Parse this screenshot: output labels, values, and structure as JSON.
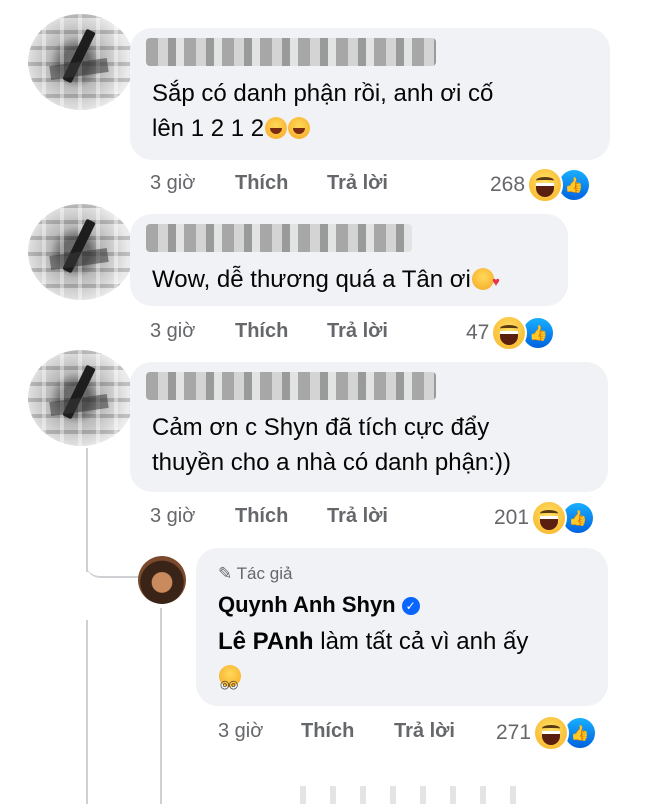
{
  "comments": [
    {
      "text_lines": [
        "Sắp có danh phận rồi, anh ơi cố",
        "lên 1 2 1 2"
      ],
      "time": "3 giờ",
      "like_label": "Thích",
      "reply_label": "Trả lời",
      "reaction_count": "268"
    },
    {
      "text_lines": [
        "Wow, dễ thương quá a Tân ơi"
      ],
      "time": "3 giờ",
      "like_label": "Thích",
      "reply_label": "Trả lời",
      "reaction_count": "47"
    },
    {
      "text_lines": [
        "Cảm ơn c Shyn đã tích cực đẩy",
        "thuyền cho a nhà có danh phận:))"
      ],
      "time": "3 giờ",
      "like_label": "Thích",
      "reply_label": "Trả lời",
      "reaction_count": "201"
    }
  ],
  "reply": {
    "author_tag": "Tác giả",
    "author_name": "Quynh Anh Shyn",
    "mention": "Lê PAnh",
    "text_rest": " làm tất cả vì anh ấy",
    "time": "3 giờ",
    "like_label": "Thích",
    "reply_label": "Trả lời",
    "reaction_count": "271"
  },
  "colors": {
    "bubble": "#f0f2f5",
    "meta": "#65676b",
    "like_blue": "#0866ff"
  },
  "icons": [
    "laughing-emoji",
    "smiling-face-with-hearts-emoji",
    "nerd-face-emoji",
    "haha-reaction-icon",
    "like-reaction-icon",
    "pencil-icon",
    "verified-badge-icon"
  ]
}
